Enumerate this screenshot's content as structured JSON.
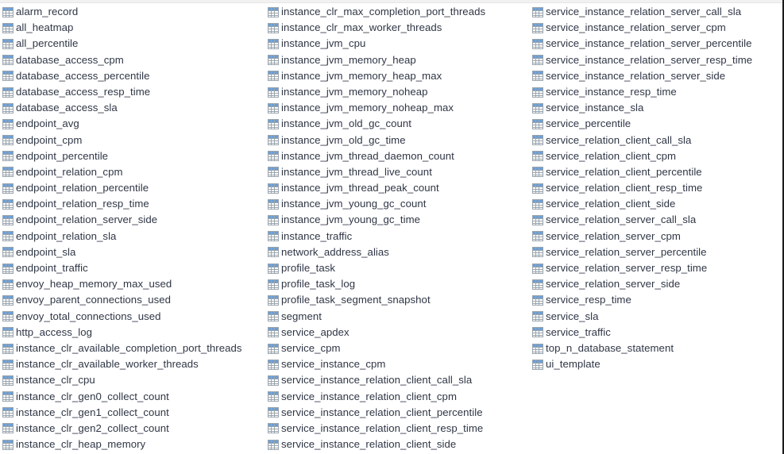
{
  "view": {
    "kind": "database-table-list",
    "icon_name": "table-icon",
    "text_color": "#2f3645",
    "background_color": "#ffffff",
    "icon_header_color": "#6a9fd8",
    "icon_grid_color": "#9aa4ad",
    "columns_count": 3
  },
  "columns": [
    {
      "name": "column-1",
      "items": [
        "alarm_record",
        "all_heatmap",
        "all_percentile",
        "database_access_cpm",
        "database_access_percentile",
        "database_access_resp_time",
        "database_access_sla",
        "endpoint_avg",
        "endpoint_cpm",
        "endpoint_percentile",
        "endpoint_relation_cpm",
        "endpoint_relation_percentile",
        "endpoint_relation_resp_time",
        "endpoint_relation_server_side",
        "endpoint_relation_sla",
        "endpoint_sla",
        "endpoint_traffic",
        "envoy_heap_memory_max_used",
        "envoy_parent_connections_used",
        "envoy_total_connections_used",
        "http_access_log",
        "instance_clr_available_completion_port_threads",
        "instance_clr_available_worker_threads",
        "instance_clr_cpu",
        "instance_clr_gen0_collect_count",
        "instance_clr_gen1_collect_count",
        "instance_clr_gen2_collect_count",
        "instance_clr_heap_memory"
      ]
    },
    {
      "name": "column-2",
      "items": [
        "instance_clr_max_completion_port_threads",
        "instance_clr_max_worker_threads",
        "instance_jvm_cpu",
        "instance_jvm_memory_heap",
        "instance_jvm_memory_heap_max",
        "instance_jvm_memory_noheap",
        "instance_jvm_memory_noheap_max",
        "instance_jvm_old_gc_count",
        "instance_jvm_old_gc_time",
        "instance_jvm_thread_daemon_count",
        "instance_jvm_thread_live_count",
        "instance_jvm_thread_peak_count",
        "instance_jvm_young_gc_count",
        "instance_jvm_young_gc_time",
        "instance_traffic",
        "network_address_alias",
        "profile_task",
        "profile_task_log",
        "profile_task_segment_snapshot",
        "segment",
        "service_apdex",
        "service_cpm",
        "service_instance_cpm",
        "service_instance_relation_client_call_sla",
        "service_instance_relation_client_cpm",
        "service_instance_relation_client_percentile",
        "service_instance_relation_client_resp_time",
        "service_instance_relation_client_side"
      ]
    },
    {
      "name": "column-3",
      "items": [
        "service_instance_relation_server_call_sla",
        "service_instance_relation_server_cpm",
        "service_instance_relation_server_percentile",
        "service_instance_relation_server_resp_time",
        "service_instance_relation_server_side",
        "service_instance_resp_time",
        "service_instance_sla",
        "service_percentile",
        "service_relation_client_call_sla",
        "service_relation_client_cpm",
        "service_relation_client_percentile",
        "service_relation_client_resp_time",
        "service_relation_client_side",
        "service_relation_server_call_sla",
        "service_relation_server_cpm",
        "service_relation_server_percentile",
        "service_relation_server_resp_time",
        "service_relation_server_side",
        "service_resp_time",
        "service_sla",
        "service_traffic",
        "top_n_database_statement",
        "ui_template"
      ]
    }
  ]
}
